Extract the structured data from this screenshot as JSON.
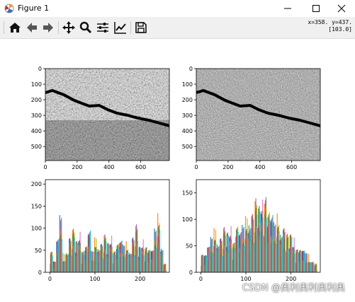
{
  "window": {
    "title": "Figure 1",
    "controls": [
      "minimize",
      "maximize",
      "close"
    ]
  },
  "toolbar": {
    "buttons": [
      {
        "name": "home",
        "icon": "home-icon"
      },
      {
        "name": "back",
        "icon": "arrow-left-icon"
      },
      {
        "name": "forward",
        "icon": "arrow-right-icon"
      },
      {
        "name": "pan",
        "icon": "move-icon"
      },
      {
        "name": "zoom",
        "icon": "zoom-icon"
      },
      {
        "name": "configure-subplots",
        "icon": "sliders-icon"
      },
      {
        "name": "edit-axes",
        "icon": "line-chart-icon"
      },
      {
        "name": "save",
        "icon": "save-icon"
      }
    ],
    "coords_line1": "x=358. y=437.",
    "coords_line2": "[103.0]"
  },
  "watermark": "CSDN @奥利奥利奥利奥",
  "chart_data": [
    {
      "type": "image",
      "xticks": [
        "0",
        "200",
        "400",
        "600"
      ],
      "yticks": [
        "0",
        "100",
        "200",
        "300",
        "400",
        "500"
      ],
      "xlim": [
        0,
        780
      ],
      "ylim": [
        590,
        0
      ]
    },
    {
      "type": "image",
      "xticks": [
        "0",
        "200",
        "400",
        "600"
      ],
      "yticks": [
        "0",
        "100",
        "200",
        "300",
        "400",
        "500"
      ],
      "xlim": [
        0,
        780
      ],
      "ylim": [
        590,
        0
      ]
    },
    {
      "type": "bar",
      "xticks": [
        "0",
        "100",
        "200"
      ],
      "yticks": [
        "0",
        "50",
        "100",
        "150",
        "200"
      ],
      "xlim": [
        -10,
        265
      ],
      "ylim": [
        0,
        210
      ],
      "bins_x": [
        0,
        7,
        14,
        21,
        28,
        35,
        42,
        49,
        56,
        63,
        70,
        77,
        84,
        91,
        98,
        105,
        112,
        119,
        126,
        133,
        140,
        147,
        154,
        161,
        168,
        175,
        182,
        189,
        196,
        203,
        210,
        217,
        224,
        231,
        238,
        245,
        252
      ],
      "values": [
        60,
        30,
        85,
        140,
        40,
        55,
        90,
        110,
        75,
        95,
        60,
        70,
        105,
        50,
        80,
        65,
        75,
        95,
        70,
        85,
        60,
        75,
        80,
        65,
        70,
        55,
        90,
        120,
        60,
        75,
        70,
        60,
        55,
        105,
        140,
        65,
        20
      ],
      "colors": [
        "#1f77b4",
        "#ff7f0e",
        "#2ca02c",
        "#d62728",
        "#9467bd",
        "#8c564b",
        "#e377c2",
        "#7f7f7f",
        "#bcbd22",
        "#17becf"
      ]
    },
    {
      "type": "bar",
      "xticks": [
        "0",
        "100",
        "200"
      ],
      "yticks": [
        "0",
        "50",
        "100",
        "150"
      ],
      "xlim": [
        -10,
        265
      ],
      "ylim": [
        0,
        175
      ],
      "bins_x": [
        0,
        7,
        14,
        21,
        28,
        35,
        42,
        49,
        56,
        63,
        70,
        77,
        84,
        91,
        98,
        105,
        112,
        119,
        126,
        133,
        140,
        147,
        154,
        161,
        168,
        175,
        182,
        189,
        196,
        203,
        210,
        217,
        224,
        231,
        238,
        245,
        252
      ],
      "values": [
        45,
        40,
        55,
        70,
        85,
        65,
        75,
        95,
        80,
        90,
        70,
        100,
        85,
        95,
        110,
        105,
        125,
        155,
        135,
        145,
        165,
        130,
        120,
        100,
        115,
        85,
        95,
        80,
        75,
        65,
        55,
        50,
        45,
        35,
        30,
        25,
        15
      ],
      "colors": [
        "#1f77b4",
        "#ff7f0e",
        "#2ca02c",
        "#d62728",
        "#9467bd",
        "#8c564b",
        "#e377c2",
        "#7f7f7f",
        "#bcbd22",
        "#17becf"
      ]
    }
  ]
}
